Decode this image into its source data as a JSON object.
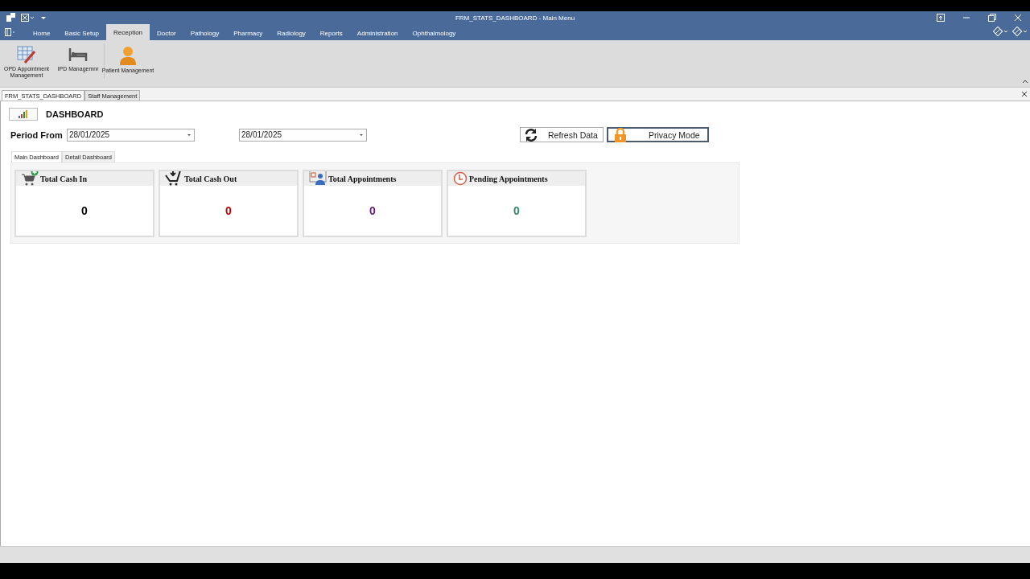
{
  "window": {
    "title": "FRM_STATS_DASHBOARD - Main Menu"
  },
  "menu_tabs": [
    {
      "label": "Home",
      "selected": false
    },
    {
      "label": "Basic Setup",
      "selected": false
    },
    {
      "label": "Reception",
      "selected": true
    },
    {
      "label": "Doctor",
      "selected": false
    },
    {
      "label": "Pathology",
      "selected": false
    },
    {
      "label": "Pharmacy",
      "selected": false
    },
    {
      "label": "Radiology",
      "selected": false
    },
    {
      "label": "Reports",
      "selected": false
    },
    {
      "label": "Administration",
      "selected": false
    },
    {
      "label": "Ophthalmology",
      "selected": false
    }
  ],
  "ribbon": [
    {
      "kind": "calendar",
      "label": "OPD Appointment Management"
    },
    {
      "kind": "bed",
      "label": "IPD Managemnr"
    },
    {
      "kind": "person",
      "label": "Patient Management"
    }
  ],
  "document_tabs": [
    {
      "label": "FRM_STATS_DASHBOARD",
      "selected": true
    },
    {
      "label": "Staff Management",
      "selected": false
    }
  ],
  "dashboard": {
    "title": "DASHBOARD",
    "period_label": "Period From",
    "date_from": "28/01/2025",
    "date_to": "28/01/2025",
    "refresh_button": "Refresh Data",
    "privacy_button": "Privacy Mode"
  },
  "dashboard_tabs": [
    {
      "label": "Main Dashboard",
      "selected": true
    },
    {
      "label": "Detail Dashboard",
      "selected": false
    }
  ],
  "cards": [
    {
      "kind": "cash-in",
      "title": "Total Cash In",
      "value": "0",
      "color": "#000000"
    },
    {
      "kind": "cash-out",
      "title": "Total Cash Out",
      "value": "0",
      "color": "#c00000"
    },
    {
      "kind": "appointments",
      "title": "Total Appointments",
      "value": "0",
      "color": "#6a1b7a"
    },
    {
      "kind": "pending",
      "title": "Pending Appointments",
      "value": "0",
      "color": "#2e8b6e"
    }
  ]
}
